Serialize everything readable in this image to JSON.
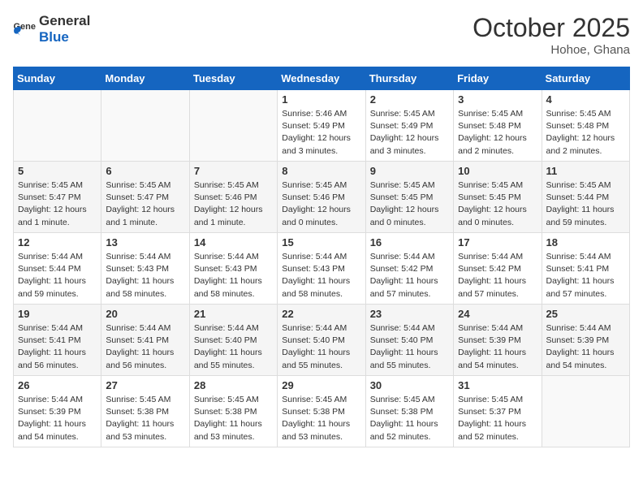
{
  "header": {
    "logo_general": "General",
    "logo_blue": "Blue",
    "month": "October 2025",
    "location": "Hohoe, Ghana"
  },
  "weekdays": [
    "Sunday",
    "Monday",
    "Tuesday",
    "Wednesday",
    "Thursday",
    "Friday",
    "Saturday"
  ],
  "weeks": [
    [
      {
        "day": "",
        "sunrise": "",
        "sunset": "",
        "daylight": ""
      },
      {
        "day": "",
        "sunrise": "",
        "sunset": "",
        "daylight": ""
      },
      {
        "day": "",
        "sunrise": "",
        "sunset": "",
        "daylight": ""
      },
      {
        "day": "1",
        "sunrise": "Sunrise: 5:46 AM",
        "sunset": "Sunset: 5:49 PM",
        "daylight": "Daylight: 12 hours and 3 minutes."
      },
      {
        "day": "2",
        "sunrise": "Sunrise: 5:45 AM",
        "sunset": "Sunset: 5:49 PM",
        "daylight": "Daylight: 12 hours and 3 minutes."
      },
      {
        "day": "3",
        "sunrise": "Sunrise: 5:45 AM",
        "sunset": "Sunset: 5:48 PM",
        "daylight": "Daylight: 12 hours and 2 minutes."
      },
      {
        "day": "4",
        "sunrise": "Sunrise: 5:45 AM",
        "sunset": "Sunset: 5:48 PM",
        "daylight": "Daylight: 12 hours and 2 minutes."
      }
    ],
    [
      {
        "day": "5",
        "sunrise": "Sunrise: 5:45 AM",
        "sunset": "Sunset: 5:47 PM",
        "daylight": "Daylight: 12 hours and 1 minute."
      },
      {
        "day": "6",
        "sunrise": "Sunrise: 5:45 AM",
        "sunset": "Sunset: 5:47 PM",
        "daylight": "Daylight: 12 hours and 1 minute."
      },
      {
        "day": "7",
        "sunrise": "Sunrise: 5:45 AM",
        "sunset": "Sunset: 5:46 PM",
        "daylight": "Daylight: 12 hours and 1 minute."
      },
      {
        "day": "8",
        "sunrise": "Sunrise: 5:45 AM",
        "sunset": "Sunset: 5:46 PM",
        "daylight": "Daylight: 12 hours and 0 minutes."
      },
      {
        "day": "9",
        "sunrise": "Sunrise: 5:45 AM",
        "sunset": "Sunset: 5:45 PM",
        "daylight": "Daylight: 12 hours and 0 minutes."
      },
      {
        "day": "10",
        "sunrise": "Sunrise: 5:45 AM",
        "sunset": "Sunset: 5:45 PM",
        "daylight": "Daylight: 12 hours and 0 minutes."
      },
      {
        "day": "11",
        "sunrise": "Sunrise: 5:45 AM",
        "sunset": "Sunset: 5:44 PM",
        "daylight": "Daylight: 11 hours and 59 minutes."
      }
    ],
    [
      {
        "day": "12",
        "sunrise": "Sunrise: 5:44 AM",
        "sunset": "Sunset: 5:44 PM",
        "daylight": "Daylight: 11 hours and 59 minutes."
      },
      {
        "day": "13",
        "sunrise": "Sunrise: 5:44 AM",
        "sunset": "Sunset: 5:43 PM",
        "daylight": "Daylight: 11 hours and 58 minutes."
      },
      {
        "day": "14",
        "sunrise": "Sunrise: 5:44 AM",
        "sunset": "Sunset: 5:43 PM",
        "daylight": "Daylight: 11 hours and 58 minutes."
      },
      {
        "day": "15",
        "sunrise": "Sunrise: 5:44 AM",
        "sunset": "Sunset: 5:43 PM",
        "daylight": "Daylight: 11 hours and 58 minutes."
      },
      {
        "day": "16",
        "sunrise": "Sunrise: 5:44 AM",
        "sunset": "Sunset: 5:42 PM",
        "daylight": "Daylight: 11 hours and 57 minutes."
      },
      {
        "day": "17",
        "sunrise": "Sunrise: 5:44 AM",
        "sunset": "Sunset: 5:42 PM",
        "daylight": "Daylight: 11 hours and 57 minutes."
      },
      {
        "day": "18",
        "sunrise": "Sunrise: 5:44 AM",
        "sunset": "Sunset: 5:41 PM",
        "daylight": "Daylight: 11 hours and 57 minutes."
      }
    ],
    [
      {
        "day": "19",
        "sunrise": "Sunrise: 5:44 AM",
        "sunset": "Sunset: 5:41 PM",
        "daylight": "Daylight: 11 hours and 56 minutes."
      },
      {
        "day": "20",
        "sunrise": "Sunrise: 5:44 AM",
        "sunset": "Sunset: 5:41 PM",
        "daylight": "Daylight: 11 hours and 56 minutes."
      },
      {
        "day": "21",
        "sunrise": "Sunrise: 5:44 AM",
        "sunset": "Sunset: 5:40 PM",
        "daylight": "Daylight: 11 hours and 55 minutes."
      },
      {
        "day": "22",
        "sunrise": "Sunrise: 5:44 AM",
        "sunset": "Sunset: 5:40 PM",
        "daylight": "Daylight: 11 hours and 55 minutes."
      },
      {
        "day": "23",
        "sunrise": "Sunrise: 5:44 AM",
        "sunset": "Sunset: 5:40 PM",
        "daylight": "Daylight: 11 hours and 55 minutes."
      },
      {
        "day": "24",
        "sunrise": "Sunrise: 5:44 AM",
        "sunset": "Sunset: 5:39 PM",
        "daylight": "Daylight: 11 hours and 54 minutes."
      },
      {
        "day": "25",
        "sunrise": "Sunrise: 5:44 AM",
        "sunset": "Sunset: 5:39 PM",
        "daylight": "Daylight: 11 hours and 54 minutes."
      }
    ],
    [
      {
        "day": "26",
        "sunrise": "Sunrise: 5:44 AM",
        "sunset": "Sunset: 5:39 PM",
        "daylight": "Daylight: 11 hours and 54 minutes."
      },
      {
        "day": "27",
        "sunrise": "Sunrise: 5:45 AM",
        "sunset": "Sunset: 5:38 PM",
        "daylight": "Daylight: 11 hours and 53 minutes."
      },
      {
        "day": "28",
        "sunrise": "Sunrise: 5:45 AM",
        "sunset": "Sunset: 5:38 PM",
        "daylight": "Daylight: 11 hours and 53 minutes."
      },
      {
        "day": "29",
        "sunrise": "Sunrise: 5:45 AM",
        "sunset": "Sunset: 5:38 PM",
        "daylight": "Daylight: 11 hours and 53 minutes."
      },
      {
        "day": "30",
        "sunrise": "Sunrise: 5:45 AM",
        "sunset": "Sunset: 5:38 PM",
        "daylight": "Daylight: 11 hours and 52 minutes."
      },
      {
        "day": "31",
        "sunrise": "Sunrise: 5:45 AM",
        "sunset": "Sunset: 5:37 PM",
        "daylight": "Daylight: 11 hours and 52 minutes."
      },
      {
        "day": "",
        "sunrise": "",
        "sunset": "",
        "daylight": ""
      }
    ]
  ]
}
